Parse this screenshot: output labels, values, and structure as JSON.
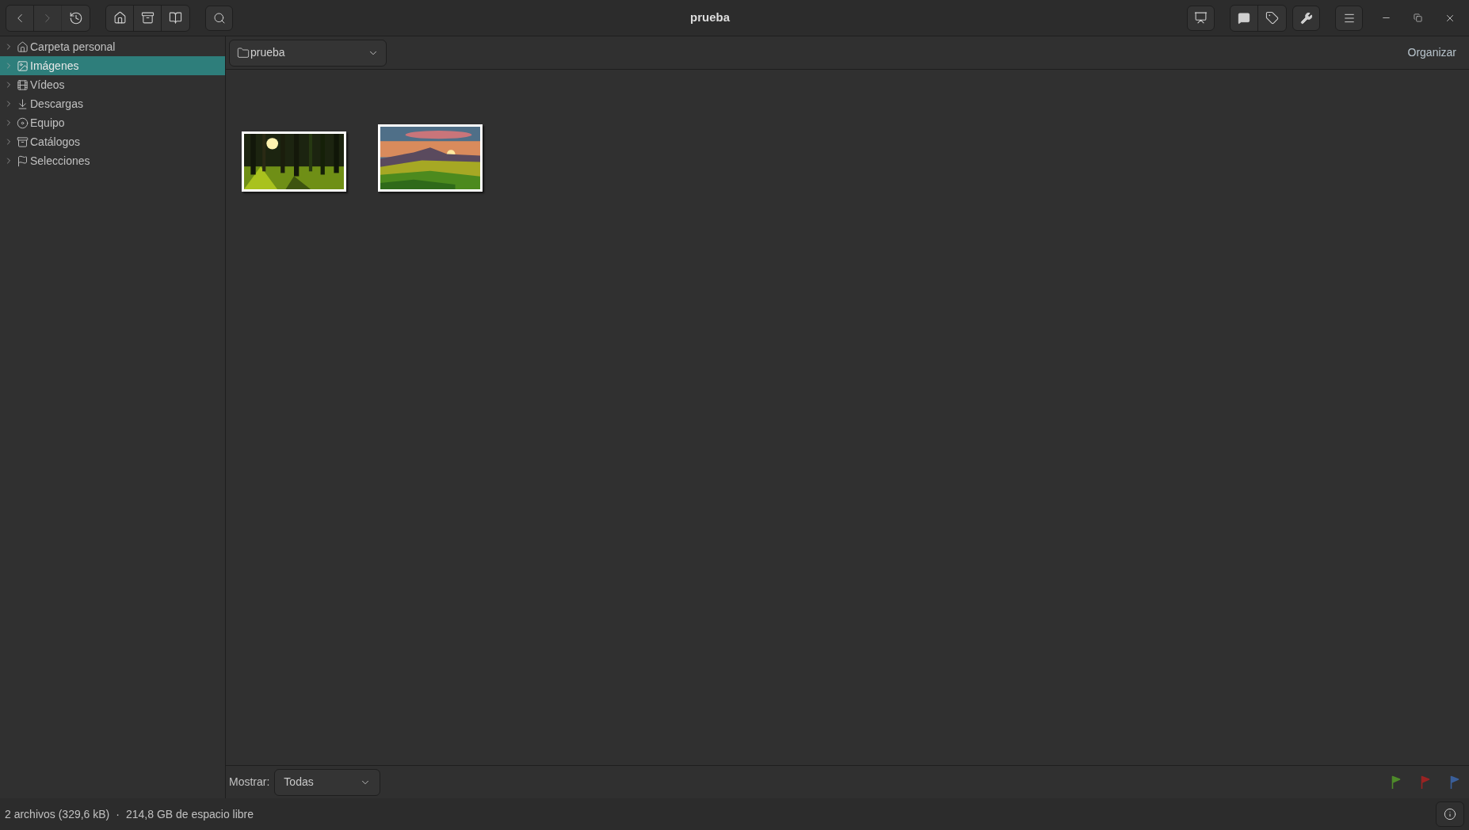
{
  "window": {
    "title": "prueba"
  },
  "sidebar": {
    "items": [
      {
        "label": "Carpeta personal",
        "selected": false
      },
      {
        "label": "Imágenes",
        "selected": true
      },
      {
        "label": "Vídeos",
        "selected": false
      },
      {
        "label": "Descargas",
        "selected": false
      },
      {
        "label": "Equipo",
        "selected": false
      },
      {
        "label": "Catálogos",
        "selected": false
      },
      {
        "label": "Selecciones",
        "selected": false
      }
    ]
  },
  "location": {
    "folder": "prueba",
    "organize_button": "Organizar"
  },
  "filter": {
    "label": "Mostrar:",
    "value": "Todas"
  },
  "flags": [
    {
      "color": "#4e8a2a"
    },
    {
      "color": "#9a2323"
    },
    {
      "color": "#3a5f9a"
    }
  ],
  "status_bar": {
    "files": "2 archivos (329,6 kB)",
    "separator": "·",
    "free_space": "214,8 GB de espacio libre"
  }
}
